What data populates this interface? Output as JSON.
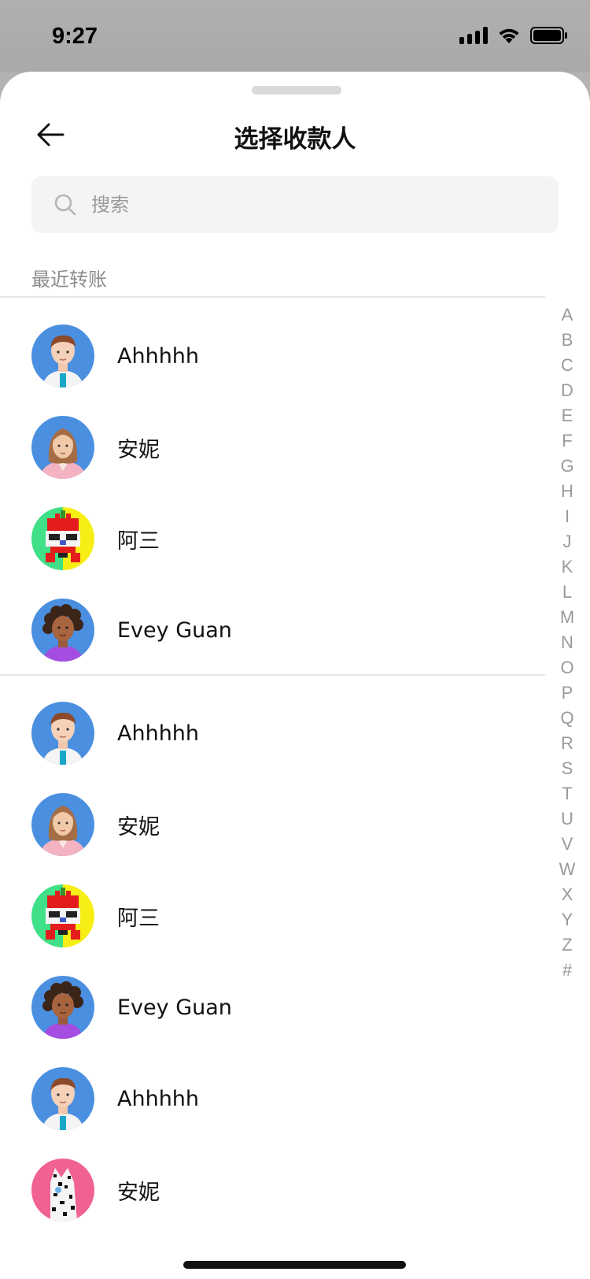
{
  "status_bar": {
    "time": "9:27"
  },
  "header": {
    "title": "选择收款人"
  },
  "search": {
    "placeholder": "搜索"
  },
  "recent": {
    "label": "最近转账",
    "contacts": [
      {
        "name": "Ahhhhh",
        "avatar": "male-3d-avatar"
      },
      {
        "name": "安妮",
        "avatar": "female-3d-avatar"
      },
      {
        "name": "阿三",
        "avatar": "pixel-robot-avatar"
      },
      {
        "name": "Evey Guan",
        "avatar": "curly-hair-3d-avatar"
      }
    ]
  },
  "all": {
    "contacts": [
      {
        "name": "Ahhhhh",
        "avatar": "male-3d-avatar"
      },
      {
        "name": "安妮",
        "avatar": "female-3d-avatar"
      },
      {
        "name": "阿三",
        "avatar": "pixel-robot-avatar"
      },
      {
        "name": "Evey Guan",
        "avatar": "curly-hair-3d-avatar"
      },
      {
        "name": "Ahhhhh",
        "avatar": "male-3d-avatar"
      },
      {
        "name": "安妮",
        "avatar": "nft-cat-avatar"
      }
    ]
  },
  "alpha_index": [
    "A",
    "B",
    "C",
    "D",
    "E",
    "F",
    "G",
    "H",
    "I",
    "J",
    "K",
    "L",
    "M",
    "N",
    "O",
    "P",
    "Q",
    "R",
    "S",
    "T",
    "U",
    "V",
    "W",
    "X",
    "Y",
    "Z",
    "#"
  ],
  "colors": {
    "accent_avatar_bg": "#4a8fe0",
    "pink_avatar_bg": "#f06292",
    "divider": "#e6e6e6",
    "secondary_text": "#8c8c8c"
  }
}
